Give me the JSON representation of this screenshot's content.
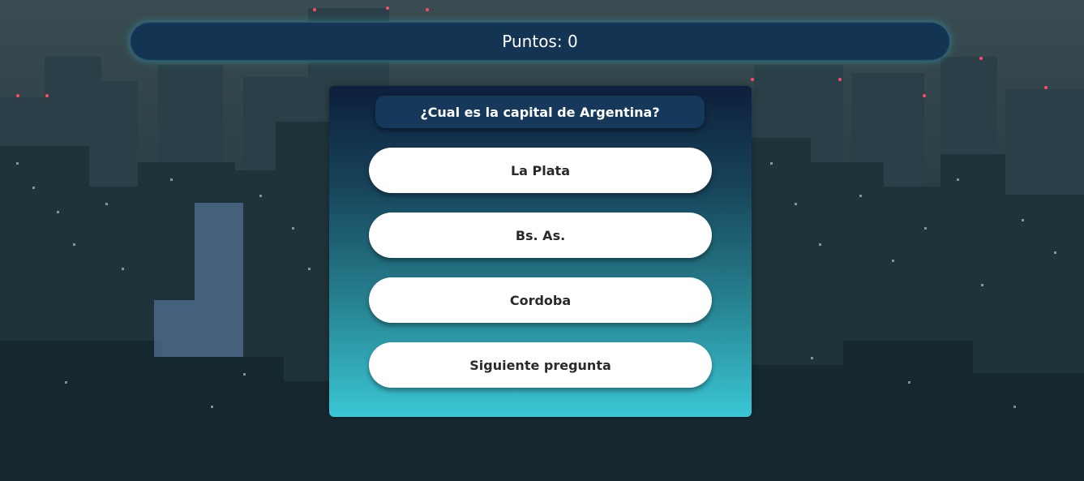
{
  "score": {
    "text": "Puntos: 0"
  },
  "quiz": {
    "question": "¿Cual es la capital de Argentina?",
    "answers": [
      {
        "label": "La Plata"
      },
      {
        "label": "Bs. As."
      },
      {
        "label": "Cordoba"
      }
    ],
    "next_label": "Siguiente pregunta"
  },
  "colors": {
    "score_bar_bg": "#133452",
    "question_bg": "#16385a",
    "card_gradient_top": "#0d1f3c",
    "card_gradient_bottom": "#3ac6d5",
    "button_bg": "#ffffff"
  }
}
